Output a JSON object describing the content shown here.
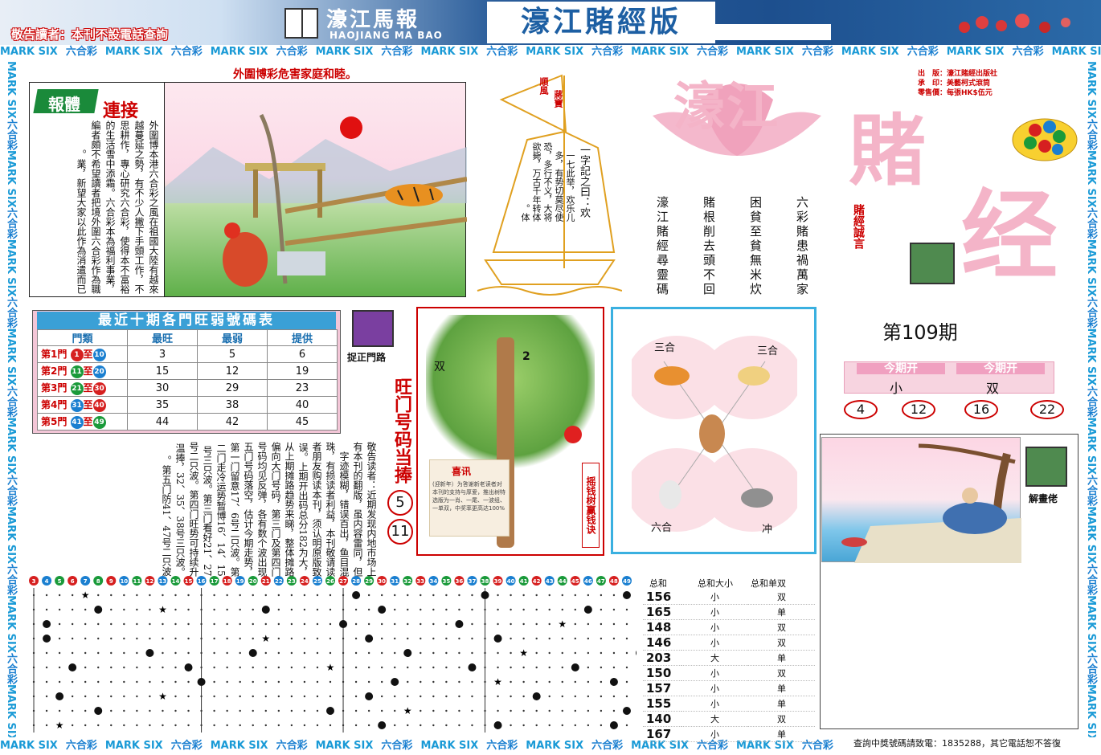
{
  "header": {
    "notice": "敬告讀者：本刊不設電話查詢",
    "brand_cn": "濠江馬報",
    "brand_en": "HAOJIANG MA BAO",
    "edition": "濠江賭經版"
  },
  "band": {
    "mark": "MARK SIX",
    "liuhe": "六合彩"
  },
  "left_box": {
    "title1": "報體",
    "title2": "連接",
    "text": "外圍博本港六合彩之風在祖國大陸有越來越蔓延之勢，有不少人撇下手頭工作，不思耕作，專心研究六合彩，使得本不富裕的生活雪中添霜。六合彩本為福利事業，編者頗不希望讀者把境外圍六合彩作為職業，新望大家以此作為消遣而已。"
  },
  "picture1": {
    "caption": "外圍博彩危害家庭和睦。"
  },
  "boat": {
    "flag1": "順風",
    "flag2": "蔣寶",
    "yizi": "一字記之曰：欢",
    "text": "一七此举，欢乐儿多，有势切莫尽使恐，多行不义，大将欲毙，万古千年转体体。"
  },
  "title": {
    "t1": "濠江",
    "t2": "賭",
    "t3": "经"
  },
  "pubinfo": [
    "出　版：濠江賭經出版社",
    "承　印：美藝柯式滾筒",
    "零售價：每張HK$伍元"
  ],
  "poems": [
    "六彩賭患禍萬家",
    "困貧至貧無米炊",
    "賭根削去頭不回",
    "濠江賭經尋靈碼"
  ],
  "motto": "賭經誠言",
  "table": {
    "title": "最近十期各門旺弱號碼表",
    "headers": [
      "門類",
      "最旺",
      "最弱",
      "提供"
    ],
    "rows": [
      {
        "gate": "第1門",
        "from": "1",
        "to": "10",
        "hot": "3",
        "cold": "5",
        "offer": "6",
        "c1": "#d62020",
        "c2": "#1a7fd0"
      },
      {
        "gate": "第2門",
        "from": "11",
        "to": "20",
        "hot": "15",
        "cold": "12",
        "offer": "19",
        "c1": "#1a9a3a",
        "c2": "#1a7fd0"
      },
      {
        "gate": "第3門",
        "from": "21",
        "to": "30",
        "hot": "30",
        "cold": "29",
        "offer": "23",
        "c1": "#1a9a3a",
        "c2": "#d62020"
      },
      {
        "gate": "第4門",
        "from": "31",
        "to": "40",
        "hot": "35",
        "cold": "38",
        "offer": "40",
        "c1": "#1a7fd0",
        "c2": "#d62020"
      },
      {
        "gate": "第5門",
        "from": "41",
        "to": "49",
        "hot": "44",
        "cold": "42",
        "offer": "45",
        "c1": "#1a7fd0",
        "c2": "#1a9a3a"
      }
    ],
    "zhi": "至"
  },
  "hand1": {
    "label": "捉正門路"
  },
  "vcol": {
    "text": "敬告读者：近期发现内地市场上有本刊的翻版，虽内容雷同，但字迹模糊，错误百出，鱼目混珠，有损读者利益，本刊敬请读者朋友购读本刊，须认明原版致误。上期开出码总分182为大，从上期摊路趋势来睇，整体摊路偏向大门号码，第三门及第四门号码均见反弹，各有数个波出现五门号码落空，估计今期走势，第一门留意17、6号二只波。第二门走冷运势暂博16、14、15号三只波。第三门看好21、27号二只波。第四门旺势可持续升温捧，32、35、38号三只波。第五门防41、47号二只波。",
    "title": "旺门号码当捧",
    "n1": "5",
    "n2": "11"
  },
  "tree": {
    "label_shuang": "双",
    "label_2": "2",
    "xun_title": "喜讯",
    "xun_text": "(迎新年）为答谢新老读者对本刊的支持与厚爱，推出树特选版为一肖、一尾、一波组、一单双，中奖率更高达100%",
    "side": "摇钱树赢钱诀"
  },
  "zodiac": {
    "tl": "三合",
    "tr": "三合",
    "bl": "六合",
    "br": "冲"
  },
  "issue": "第109期",
  "current": {
    "h1": "今期开",
    "h2": "今期开",
    "v1": "小",
    "v2": "双",
    "nums": [
      "4",
      "12",
      "16",
      "22"
    ]
  },
  "hand3": {
    "label": "解畫佬"
  },
  "chart_data": {
    "type": "scatter",
    "x": [
      "3",
      "4",
      "5",
      "6",
      "7",
      "8",
      "9",
      "10",
      "11",
      "12",
      "13",
      "14",
      "15",
      "16",
      "17",
      "18",
      "19",
      "20",
      "21",
      "22",
      "23",
      "24",
      "25",
      "26",
      "27",
      "28",
      "29",
      "30",
      "31",
      "32",
      "33",
      "34",
      "35",
      "36",
      "37",
      "38",
      "39",
      "40",
      "41",
      "42",
      "43",
      "44",
      "45",
      "46",
      "47",
      "48",
      "49"
    ],
    "rows": [
      {
        "sum": "156",
        "bigsmall": "小",
        "oddeven": "双",
        "marks": [
          [
            4,
            "star"
          ],
          [
            25,
            "dot"
          ],
          [
            35,
            "dot"
          ],
          [
            46,
            "dot"
          ]
        ]
      },
      {
        "sum": "165",
        "bigsmall": "小",
        "oddeven": "单",
        "marks": [
          [
            5,
            "dot"
          ],
          [
            10,
            "star"
          ],
          [
            18,
            "dot"
          ],
          [
            27,
            "dot"
          ],
          [
            43,
            "dot"
          ]
        ]
      },
      {
        "sum": "148",
        "bigsmall": "小",
        "oddeven": "双",
        "marks": [
          [
            1,
            "dot"
          ],
          [
            24,
            "dot"
          ],
          [
            33,
            "dot"
          ],
          [
            41,
            "star"
          ]
        ]
      },
      {
        "sum": "146",
        "bigsmall": "小",
        "oddeven": "双",
        "marks": [
          [
            1,
            "dot"
          ],
          [
            18,
            "star"
          ],
          [
            26,
            "dot"
          ],
          [
            36,
            "dot"
          ]
        ]
      },
      {
        "sum": "203",
        "bigsmall": "大",
        "oddeven": "单",
        "marks": [
          [
            9,
            "dot"
          ],
          [
            17,
            "dot"
          ],
          [
            29,
            "dot"
          ],
          [
            38,
            "star"
          ],
          [
            47,
            "dot"
          ]
        ]
      },
      {
        "sum": "150",
        "bigsmall": "小",
        "oddeven": "双",
        "marks": [
          [
            3,
            "dot"
          ],
          [
            12,
            "dot"
          ],
          [
            23,
            "star"
          ],
          [
            34,
            "dot"
          ],
          [
            42,
            "dot"
          ]
        ]
      },
      {
        "sum": "157",
        "bigsmall": "小",
        "oddeven": "单",
        "marks": [
          [
            13,
            "dot"
          ],
          [
            28,
            "dot"
          ],
          [
            36,
            "star"
          ],
          [
            45,
            "dot"
          ]
        ]
      },
      {
        "sum": "155",
        "bigsmall": "小",
        "oddeven": "单",
        "marks": [
          [
            2,
            "dot"
          ],
          [
            10,
            "star"
          ],
          [
            26,
            "dot"
          ],
          [
            39,
            "dot"
          ]
        ]
      },
      {
        "sum": "140",
        "bigsmall": "大",
        "oddeven": "双",
        "marks": [
          [
            5,
            "dot"
          ],
          [
            23,
            "dot"
          ],
          [
            29,
            "star"
          ],
          [
            46,
            "dot"
          ]
        ]
      },
      {
        "sum": "167",
        "bigsmall": "小",
        "oddeven": "单",
        "marks": [
          [
            2,
            "star"
          ],
          [
            27,
            "dot"
          ],
          [
            36,
            "dot"
          ],
          [
            45,
            "dot"
          ]
        ]
      }
    ],
    "head": {
      "sum": "总和",
      "bs": "总和大小",
      "oe": "总和单双"
    }
  },
  "inquiry": "查詢中獎號碼請致電：1835288，其它電話恕不答復"
}
